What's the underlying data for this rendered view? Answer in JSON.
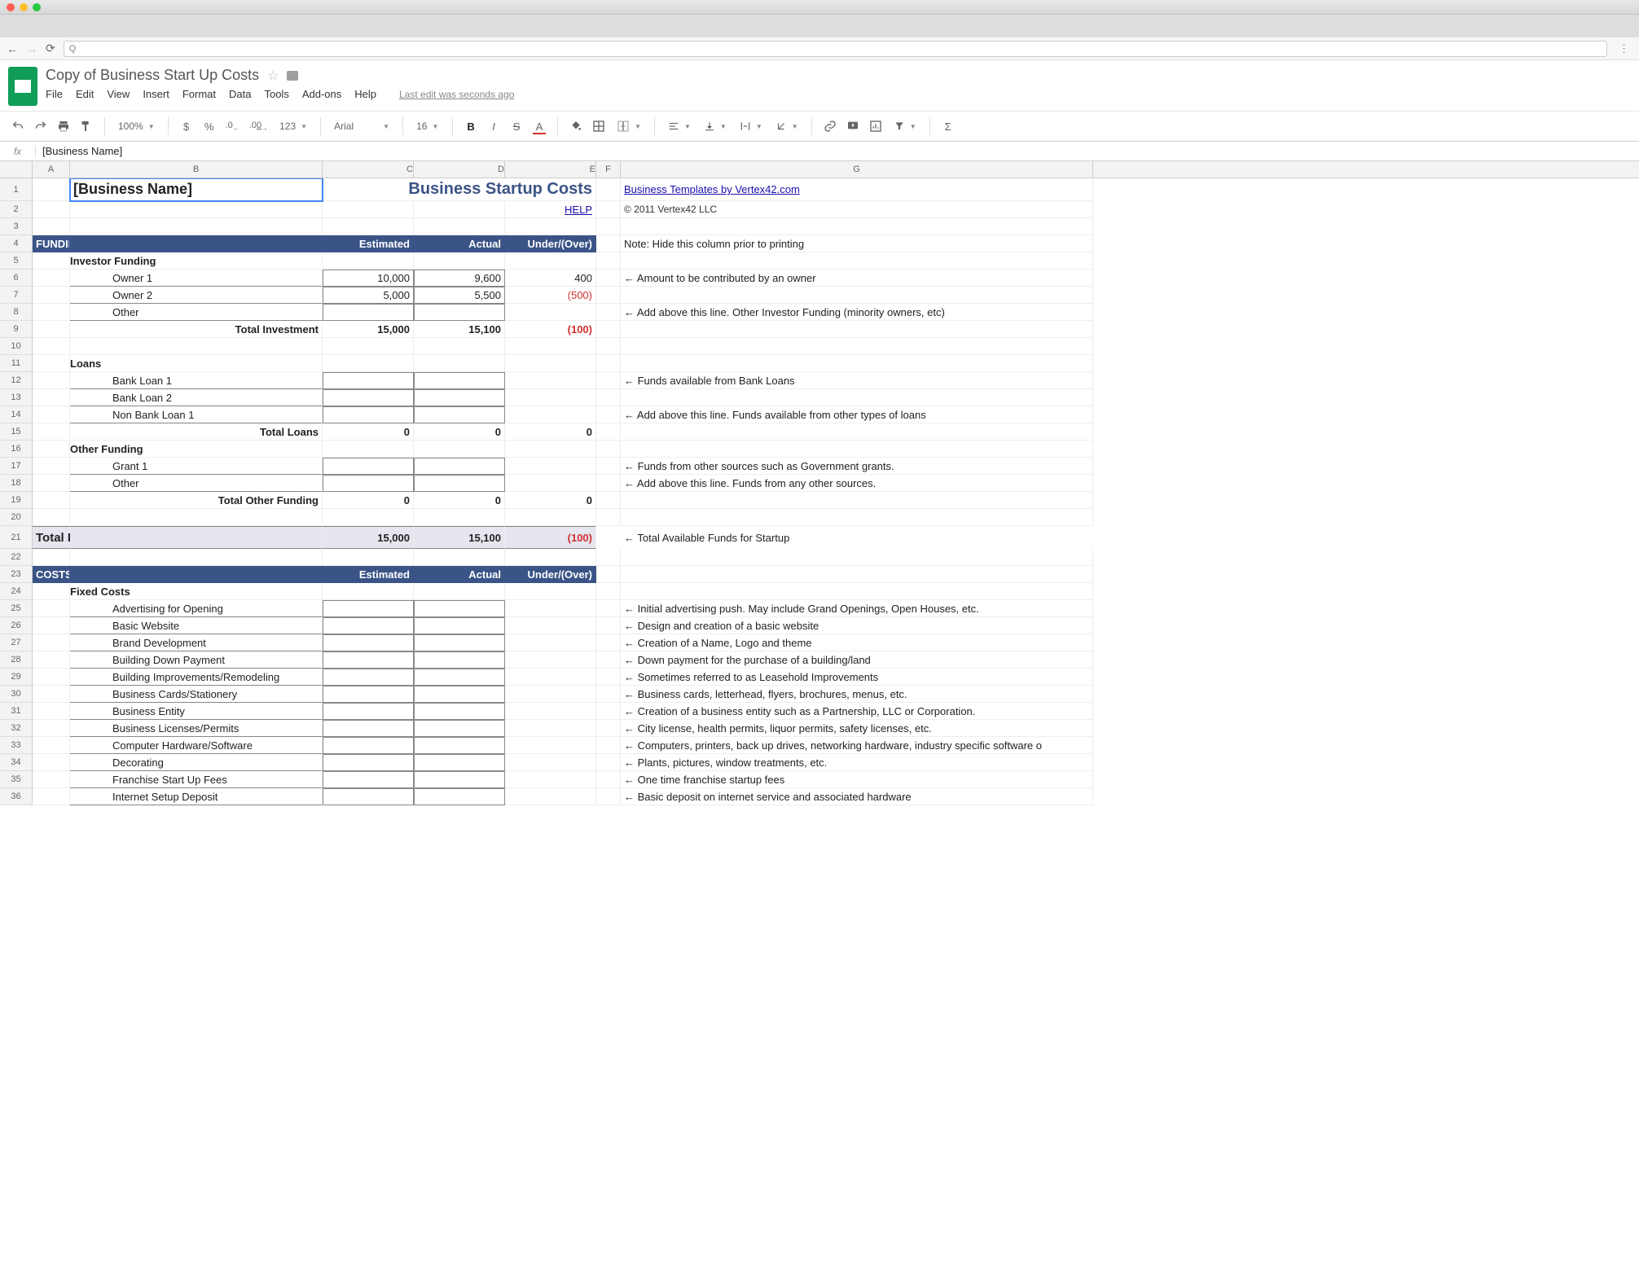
{
  "browser": {
    "addr_prefix": "Q"
  },
  "doc": {
    "title": "Copy of Business Start Up Costs",
    "last_edit": "Last edit was seconds ago",
    "menus": [
      "File",
      "Edit",
      "View",
      "Insert",
      "Format",
      "Data",
      "Tools",
      "Add-ons",
      "Help"
    ]
  },
  "toolbar": {
    "zoom": "100%",
    "currency": "$",
    "percent": "%",
    "dec_dec": ".0",
    "dec_inc": ".00",
    "format123": "123",
    "font": "Arial",
    "size": "16",
    "bold": "B",
    "italic": "I",
    "strike": "S",
    "textcolor": "A"
  },
  "formula": {
    "fx": "fx",
    "value": "[Business Name]"
  },
  "columns": [
    "A",
    "B",
    "C",
    "D",
    "E",
    "F",
    "G"
  ],
  "sheet": {
    "business_name": "[Business Name]",
    "title": "Business Startup Costs",
    "templates_link": "Business Templates by Vertex42.com",
    "help_link": "HELP",
    "copyright": "© 2011 Vertex42 LLC",
    "note_print": "Note: Hide this column prior to printing",
    "funding": {
      "header": "FUNDING",
      "col_est": "Estimated",
      "col_act": "Actual",
      "col_uo": "Under/(Over)",
      "investor_heading": "Investor Funding",
      "investors": [
        {
          "label": "Owner 1",
          "est": "10,000",
          "act": "9,600",
          "uo": "400",
          "note": "← Amount to be contributed by an owner"
        },
        {
          "label": "Owner 2",
          "est": "5,000",
          "act": "5,500",
          "uo": "(500)",
          "neg": true,
          "note": ""
        },
        {
          "label": "Other",
          "est": "",
          "act": "",
          "uo": "",
          "note": "← Add above this line. Other Investor Funding (minority owners, etc)"
        }
      ],
      "total_investment": {
        "label": "Total Investment",
        "est": "15,000",
        "act": "15,100",
        "uo": "(100)"
      },
      "loans_heading": "Loans",
      "loans": [
        {
          "label": "Bank Loan 1",
          "note": "← Funds available from Bank Loans"
        },
        {
          "label": "Bank Loan 2",
          "note": ""
        },
        {
          "label": "Non Bank Loan 1",
          "note": "← Add above this line. Funds available from other types of loans"
        }
      ],
      "total_loans": {
        "label": "Total Loans",
        "est": "0",
        "act": "0",
        "uo": "0"
      },
      "other_heading": "Other Funding",
      "others": [
        {
          "label": "Grant 1",
          "note": "← Funds from other sources such as Government grants."
        },
        {
          "label": "Other",
          "note": "← Add above this line. Funds from any other sources."
        }
      ],
      "total_other": {
        "label": "Total Other Funding",
        "est": "0",
        "act": "0",
        "uo": "0"
      },
      "total_funding": {
        "label": "Total FUNDING",
        "est": "15,000",
        "act": "15,100",
        "uo": "(100)",
        "note": "← Total Available Funds for Startup"
      }
    },
    "costs": {
      "header": "COSTS",
      "col_est": "Estimated",
      "col_act": "Actual",
      "col_uo": "Under/(Over)",
      "fixed_heading": "Fixed Costs",
      "fixed": [
        {
          "label": "Advertising for Opening",
          "note": "← Initial advertising push.  May include Grand Openings, Open Houses, etc."
        },
        {
          "label": "Basic Website",
          "note": "← Design and creation of a basic website"
        },
        {
          "label": "Brand Development",
          "note": "← Creation of a Name, Logo and theme"
        },
        {
          "label": "Building Down Payment",
          "note": "← Down payment for the purchase of a building/land"
        },
        {
          "label": "Building Improvements/Remodeling",
          "note": "← Sometimes referred to as Leasehold Improvements"
        },
        {
          "label": "Business Cards/Stationery",
          "note": "← Business cards, letterhead, flyers, brochures, menus, etc."
        },
        {
          "label": "Business Entity",
          "note": "← Creation of a business entity such as a Partnership, LLC or Corporation."
        },
        {
          "label": "Business Licenses/Permits",
          "note": "← City license, health permits, liquor permits, safety licenses, etc."
        },
        {
          "label": "Computer Hardware/Software",
          "note": "← Computers, printers, back up drives, networking hardware, industry specific software o"
        },
        {
          "label": "Decorating",
          "note": "← Plants, pictures, window treatments, etc."
        },
        {
          "label": "Franchise Start Up Fees",
          "note": "← One time franchise startup fees"
        },
        {
          "label": "Internet Setup Deposit",
          "note": "← Basic deposit on internet service and associated hardware"
        }
      ]
    }
  }
}
